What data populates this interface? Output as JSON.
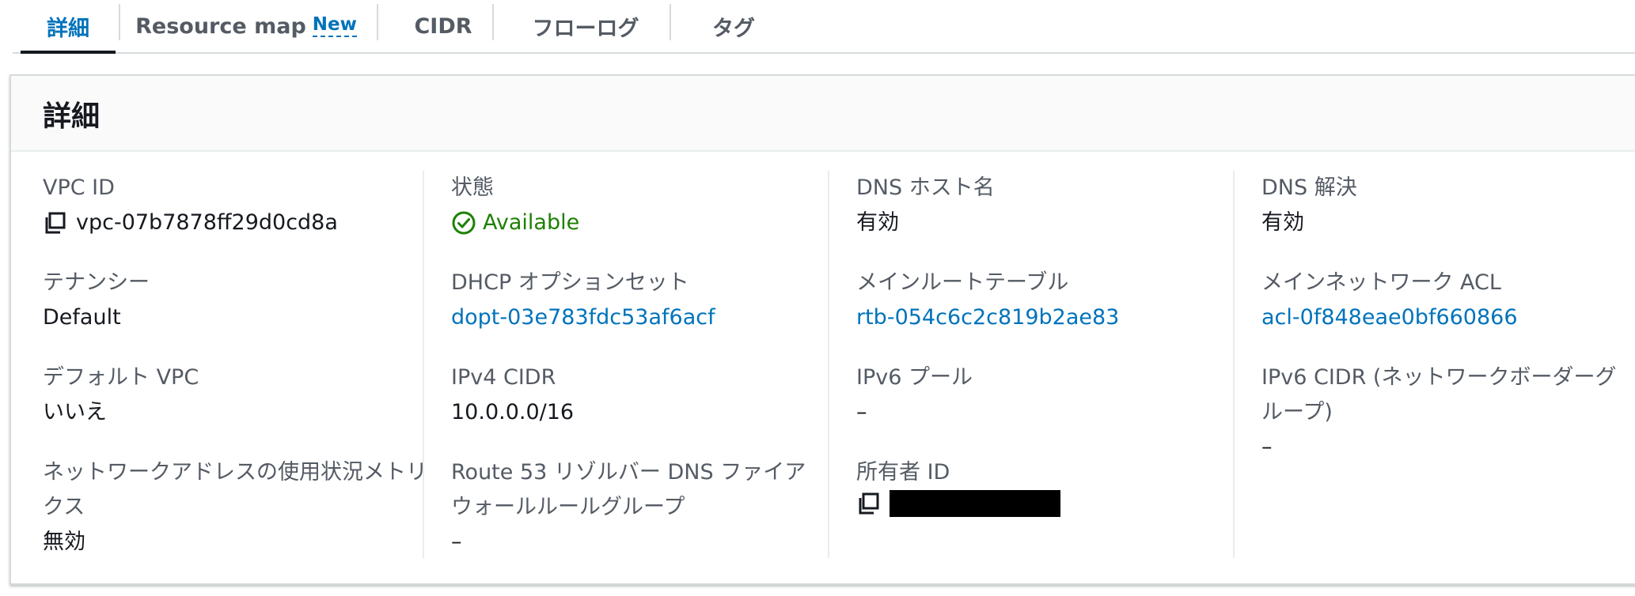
{
  "tabs": [
    {
      "label": "詳細",
      "active": true
    },
    {
      "label": "Resource map",
      "badge": "New"
    },
    {
      "label": "CIDR"
    },
    {
      "label": "フローログ"
    },
    {
      "label": "タグ"
    }
  ],
  "panel": {
    "title": "詳細"
  },
  "columns": [
    {
      "fields": [
        {
          "label": "VPC ID",
          "value": "vpc-07b7878ff29d0cd8a",
          "copy": true
        },
        {
          "label": "テナンシー",
          "value": "Default"
        },
        {
          "label": "デフォルト VPC",
          "value": "いいえ"
        },
        {
          "label": "ネットワークアドレスの使用状況メトリクス",
          "value": "無効"
        }
      ]
    },
    {
      "fields": [
        {
          "label": "状態",
          "value": "Available",
          "status": "success"
        },
        {
          "label": "DHCP オプションセット",
          "value": "dopt-03e783fdc53af6acf",
          "link": true
        },
        {
          "label": "IPv4 CIDR",
          "value": "10.0.0.0/16"
        },
        {
          "label": "Route 53 リゾルバー DNS ファイアウォールルールグループ",
          "value": "–"
        }
      ]
    },
    {
      "fields": [
        {
          "label": "DNS ホスト名",
          "value": "有効"
        },
        {
          "label": "メインルートテーブル",
          "value": "rtb-054c6c2c819b2ae83",
          "link": true
        },
        {
          "label": "IPv6 プール",
          "value": "–"
        },
        {
          "label": "所有者 ID",
          "value": "",
          "copy": true,
          "redacted": true
        }
      ]
    },
    {
      "fields": [
        {
          "label": "DNS 解決",
          "value": "有効"
        },
        {
          "label": "メインネットワーク ACL",
          "value": "acl-0f848eae0bf660866",
          "link": true
        },
        {
          "label": "IPv6 CIDR (ネットワークボーダーグループ)",
          "value": "–"
        }
      ]
    }
  ],
  "colors": {
    "accent": "#0073bb",
    "success": "#1d8102",
    "label": "#545b64",
    "text": "#16191f"
  },
  "icons": {
    "copy": "copy-icon",
    "status_success": "status-success-icon"
  }
}
